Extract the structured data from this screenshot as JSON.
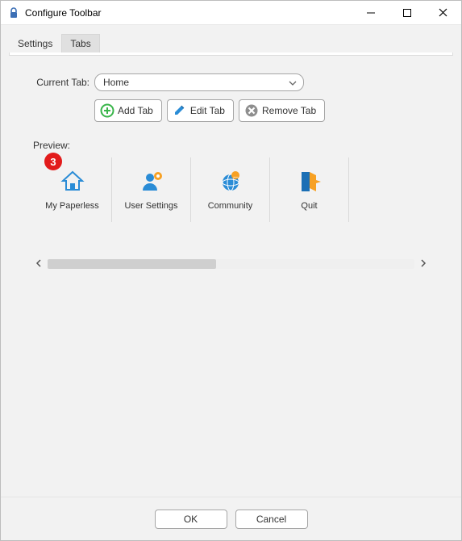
{
  "window": {
    "title": "Configure Toolbar"
  },
  "tabs": {
    "settings": "Settings",
    "current": "Tabs"
  },
  "currentTab": {
    "label": "Current Tab:",
    "value": "Home"
  },
  "actions": {
    "add": "Add Tab",
    "edit": "Edit Tab",
    "remove": "Remove Tab"
  },
  "preview": {
    "label": "Preview:",
    "items": [
      {
        "label": "My Paperless",
        "badge": "3"
      },
      {
        "label": "User Settings"
      },
      {
        "label": "Community"
      },
      {
        "label": "Quit"
      }
    ]
  },
  "footer": {
    "ok": "OK",
    "cancel": "Cancel"
  }
}
